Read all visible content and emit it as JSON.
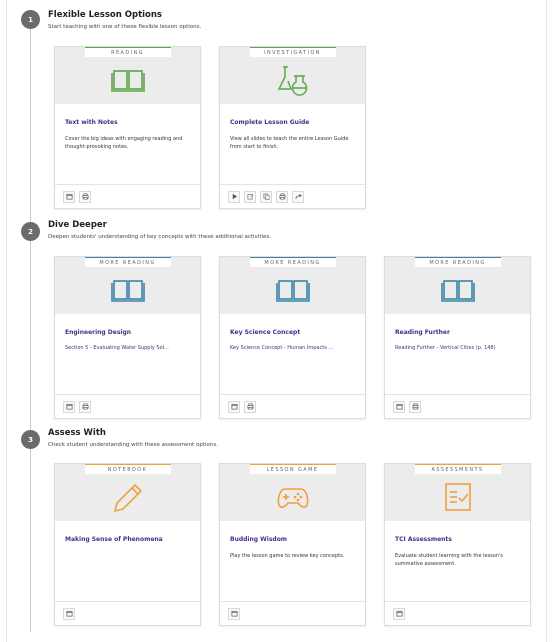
{
  "sections": [
    {
      "number": "1",
      "title": "Flexible Lesson Options",
      "subtitle": "Start teaching with one of these flexible lesson options.",
      "cards": [
        {
          "tag": "READING",
          "title": "Text with Notes",
          "desc": "Cover the big ideas with engaging reading and thought-provoking notes.",
          "icon": "book-icon"
        },
        {
          "tag": "INVESTIGATION",
          "title": "Complete Lesson Guide",
          "desc": "View all slides to teach the entire Lesson Guide from start to finish.",
          "icon": "flask-icon"
        }
      ]
    },
    {
      "number": "2",
      "title": "Dive Deeper",
      "subtitle": "Deepen students' understanding of key concepts with these additional activities.",
      "cards": [
        {
          "tag": "MORE READING",
          "title": "Engineering Design",
          "link": "Section 5 - Evaluating Water Supply Sol...",
          "icon": "book-icon"
        },
        {
          "tag": "MORE READING",
          "title": "Key Science Concept",
          "link": "Key Science Concept - Human Impacts ...",
          "icon": "book-icon"
        },
        {
          "tag": "MORE READING",
          "title": "Reading Further",
          "link": "Reading Further - Vertical Cities (p. 148)",
          "icon": "book-icon"
        }
      ]
    },
    {
      "number": "3",
      "title": "Assess With",
      "subtitle": "Check student understanding with these assessment options.",
      "cards": [
        {
          "tag": "NOTEBOOK",
          "title": "Making Sense of Phenomena",
          "desc": "",
          "icon": "pencil-icon"
        },
        {
          "tag": "LESSON GAME",
          "title": "Budding Wisdom",
          "desc": "Play the lesson game to review key concepts.",
          "icon": "gamepad-icon"
        },
        {
          "tag": "ASSESSMENTS",
          "title": "TCI Assessments",
          "desc": "Evaluate student learning with the lesson's summative assessment.",
          "icon": "assessment-icon"
        }
      ]
    }
  ],
  "colors": {
    "green": "#5aa84a",
    "blue": "#3a86a8",
    "orange": "#f0a040",
    "title_purple": "#4b2c8a"
  }
}
